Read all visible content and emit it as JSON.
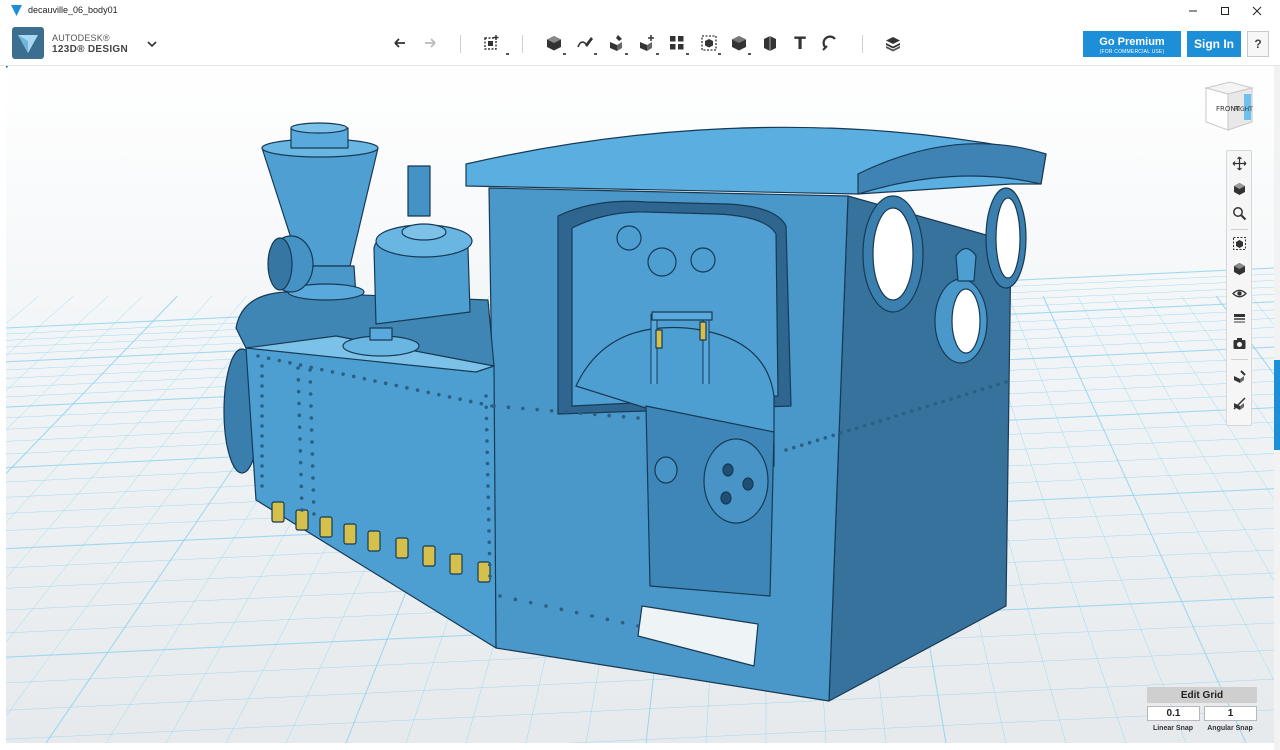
{
  "window": {
    "title": "decauville_06_body01",
    "minimize_icon": "minimize-icon",
    "maximize_icon": "maximize-icon",
    "close_icon": "close-icon"
  },
  "brand": {
    "line1": "AUTODESK®",
    "line2": "123D® DESIGN",
    "menu_icon": "chevron-down-icon"
  },
  "toolbar": {
    "tools": [
      "undo-icon",
      "redo-icon",
      "transform-icon",
      "primitives-icon",
      "sketch-icon",
      "construct-icon",
      "modify-icon",
      "pattern-icon",
      "grouping-icon",
      "combine-icon",
      "measure-icon",
      "text-icon",
      "snap-icon",
      "material-icon"
    ],
    "text_tool_glyph": "T"
  },
  "account": {
    "premium_label": "Go Premium",
    "premium_sub": "(FOR COMMERCIAL USE)",
    "signin_label": "Sign In",
    "help_label": "?"
  },
  "viewcube": {
    "front": "FRONT",
    "right": "RIGHT"
  },
  "navbar": {
    "items": [
      "pan-icon",
      "orbit-icon",
      "zoom-icon",
      "fit-icon",
      "view-icon",
      "visibility-icon",
      "materials-icon",
      "screenshot-icon",
      "snap-on-icon",
      "snap-off-icon"
    ]
  },
  "grid": {
    "edit_label": "Edit Grid",
    "linear_value": "0.1",
    "angular_value": "1",
    "linear_label": "Linear Snap",
    "angular_label": "Angular Snap"
  },
  "colors": {
    "accent": "#1c8fd8",
    "model": "#4c9fd0",
    "grid_line": "#8fd2f0",
    "pins": "#d4c04a"
  }
}
